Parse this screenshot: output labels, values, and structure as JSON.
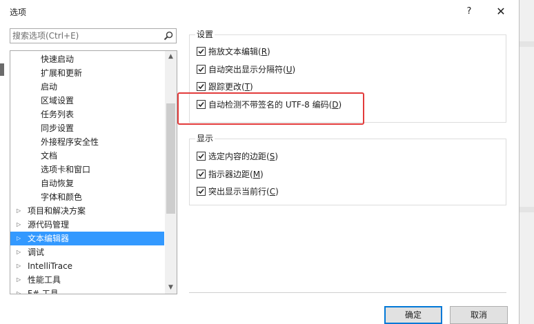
{
  "window": {
    "title": "选项",
    "help_label": "?",
    "close_label": "✕"
  },
  "search": {
    "placeholder": "搜索选项(Ctrl+E)",
    "value": ""
  },
  "tree": {
    "items": [
      {
        "label": "快速启动",
        "level": 1,
        "expander": ""
      },
      {
        "label": "扩展和更新",
        "level": 1,
        "expander": ""
      },
      {
        "label": "启动",
        "level": 1,
        "expander": ""
      },
      {
        "label": "区域设置",
        "level": 1,
        "expander": ""
      },
      {
        "label": "任务列表",
        "level": 1,
        "expander": ""
      },
      {
        "label": "同步设置",
        "level": 1,
        "expander": ""
      },
      {
        "label": "外接程序安全性",
        "level": 1,
        "expander": ""
      },
      {
        "label": "文档",
        "level": 1,
        "expander": ""
      },
      {
        "label": "选项卡和窗口",
        "level": 1,
        "expander": ""
      },
      {
        "label": "自动恢复",
        "level": 1,
        "expander": ""
      },
      {
        "label": "字体和颜色",
        "level": 1,
        "expander": ""
      },
      {
        "label": "项目和解决方案",
        "level": 0,
        "expander": "▷"
      },
      {
        "label": "源代码管理",
        "level": 0,
        "expander": "▷"
      },
      {
        "label": "文本编辑器",
        "level": 0,
        "expander": "▷",
        "selected": true
      },
      {
        "label": "调试",
        "level": 0,
        "expander": "▷"
      },
      {
        "label": "IntelliTrace",
        "level": 0,
        "expander": "▷"
      },
      {
        "label": "性能工具",
        "level": 0,
        "expander": "▷"
      },
      {
        "label": "F# 工具",
        "level": 0,
        "expander": "▷"
      }
    ],
    "scroll_up": "▲",
    "scroll_down": "▼"
  },
  "settings_group": {
    "title": "设置",
    "options": [
      {
        "text": "拖放文本编辑(",
        "key": "R",
        "suffix": ")",
        "checked": true
      },
      {
        "text": "自动突出显示分隔符(",
        "key": "U",
        "suffix": ")",
        "checked": true
      },
      {
        "text": "跟踪更改(",
        "key": "T",
        "suffix": ")",
        "checked": true
      },
      {
        "text": "自动检测不带签名的 UTF-8 编码(",
        "key": "D",
        "suffix": ")",
        "checked": true
      }
    ]
  },
  "display_group": {
    "title": "显示",
    "options": [
      {
        "text": "选定内容的边距(",
        "key": "S",
        "suffix": ")",
        "checked": true
      },
      {
        "text": "指示器边距(",
        "key": "M",
        "suffix": ")",
        "checked": true
      },
      {
        "text": "突出显示当前行(",
        "key": "C",
        "suffix": ")",
        "checked": true
      }
    ]
  },
  "buttons": {
    "ok": "确定",
    "cancel": "取消"
  },
  "colors": {
    "selection": "#3399ff",
    "highlight_box": "#e23a3a",
    "default_button_border": "#0078d7"
  }
}
